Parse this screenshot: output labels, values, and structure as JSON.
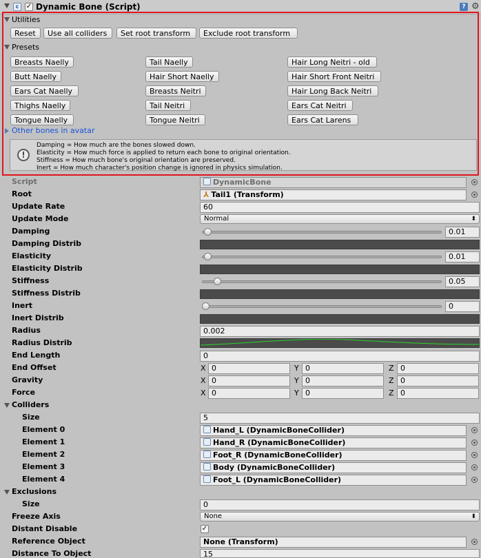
{
  "component": {
    "title": "Dynamic Bone (Script)",
    "enabled": true,
    "icons": [
      "script-icon",
      "help-icon",
      "gear-icon"
    ]
  },
  "utilities": {
    "label": "Utilities",
    "buttons": [
      "Reset",
      "Use all colliders",
      "Set root transform",
      "Exclude root transform"
    ]
  },
  "presets": {
    "label": "Presets",
    "col1": [
      "Breasts Naelly",
      "Butt Naelly",
      "Ears Cat Naelly",
      "Thighs Naelly",
      "Tongue Naelly"
    ],
    "col2": [
      "Tail Naelly",
      "Hair Short Naelly",
      "Breasts Neitri",
      "Tail Neitri",
      "Tongue Neitri"
    ],
    "col3": [
      "Hair Long Neitri - old",
      "Hair Short Front Neitri",
      "Hair Long Back Neitri",
      "Ears Cat Neitri",
      "Ears Cat Larens"
    ]
  },
  "other_bones": "Other bones in avatar",
  "help": {
    "lines": [
      "Damping = How much are the bones slowed down.",
      "Elasticity = How much force is applied to return each bone to original orientation.",
      "Stiffness = How much bone's original orientation are preserved.",
      "Inert = How much character's position change is ignored in physics simulation."
    ]
  },
  "props": {
    "script": {
      "label": "Script",
      "value": "DynamicBone"
    },
    "root": {
      "label": "Root",
      "value": "Tail1 (Transform)"
    },
    "update_rate": {
      "label": "Update Rate",
      "value": "60"
    },
    "update_mode": {
      "label": "Update Mode",
      "value": "Normal"
    },
    "damping": {
      "label": "Damping",
      "value": "0.01",
      "slider": 0.01
    },
    "damping_distrib": {
      "label": "Damping Distrib"
    },
    "elasticity": {
      "label": "Elasticity",
      "value": "0.01",
      "slider": 0.01
    },
    "elasticity_distrib": {
      "label": "Elasticity Distrib"
    },
    "stiffness": {
      "label": "Stiffness",
      "value": "0.05",
      "slider": 0.05
    },
    "stiffness_distrib": {
      "label": "Stiffness Distrib"
    },
    "inert": {
      "label": "Inert",
      "value": "0",
      "slider": 0
    },
    "inert_distrib": {
      "label": "Inert Distrib"
    },
    "radius": {
      "label": "Radius",
      "value": "0.002"
    },
    "radius_distrib": {
      "label": "Radius Distrib",
      "curve_color": "#2bd62b"
    },
    "end_length": {
      "label": "End Length",
      "value": "0"
    },
    "end_offset": {
      "label": "End Offset",
      "x": "0",
      "y": "0",
      "z": "0"
    },
    "gravity": {
      "label": "Gravity",
      "x": "0",
      "y": "0",
      "z": "0"
    },
    "force": {
      "label": "Force",
      "x": "0",
      "y": "0",
      "z": "0"
    },
    "axis": {
      "x": "X",
      "y": "Y",
      "z": "Z"
    },
    "colliders": {
      "label": "Colliders",
      "size_label": "Size",
      "size": "5",
      "elements": [
        {
          "label": "Element 0",
          "value": "Hand_L (DynamicBoneCollider)"
        },
        {
          "label": "Element 1",
          "value": "Hand_R (DynamicBoneCollider)"
        },
        {
          "label": "Element 2",
          "value": "Foot_R (DynamicBoneCollider)"
        },
        {
          "label": "Element 3",
          "value": "Body (DynamicBoneCollider)"
        },
        {
          "label": "Element 4",
          "value": "Foot_L (DynamicBoneCollider)"
        }
      ]
    },
    "exclusions": {
      "label": "Exclusions",
      "size_label": "Size",
      "size": "0"
    },
    "freeze_axis": {
      "label": "Freeze Axis",
      "value": "None"
    },
    "distant_disable": {
      "label": "Distant Disable",
      "checked": true
    },
    "reference_object": {
      "label": "Reference Object",
      "value": "None (Transform)"
    },
    "distance_to_object": {
      "label": "Distance To Object",
      "value": "15"
    }
  },
  "colors": {
    "highlight_border": "#e0151e",
    "link": "#1a55d6",
    "panel_bg": "#c2c2c2",
    "curve_bg": "#4b4b4b"
  }
}
